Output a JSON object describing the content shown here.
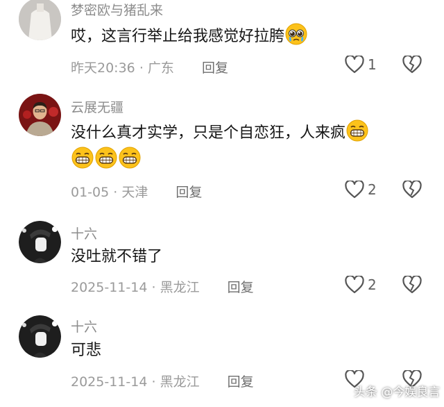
{
  "comments": [
    {
      "username": "梦密欧与猪乱来",
      "text": "哎，这言行举止给我感觉好拉胯",
      "date": "昨天20:36",
      "location": "广东",
      "reply_label": "回复",
      "likes": "1",
      "text_emoji": "pleading-face",
      "extra_emoji": []
    },
    {
      "username": "云展无疆",
      "text": "没什么真才实学，只是个自恋狂，人来疯",
      "date": "01-05",
      "location": "天津",
      "reply_label": "回复",
      "likes": "2",
      "text_emoji": "grinning-face",
      "extra_emoji": [
        "grinning-face",
        "grinning-face",
        "grinning-face"
      ]
    },
    {
      "username": "十六",
      "text": "没吐就不错了",
      "date": "2025-11-14",
      "location": "黑龙江",
      "reply_label": "回复",
      "likes": "2"
    },
    {
      "username": "十六",
      "text": "可悲",
      "date": "2025-11-14",
      "location": "黑龙江",
      "reply_label": "回复",
      "likes": ""
    }
  ],
  "separator": "·",
  "watermark": "头条 @今娱良言"
}
